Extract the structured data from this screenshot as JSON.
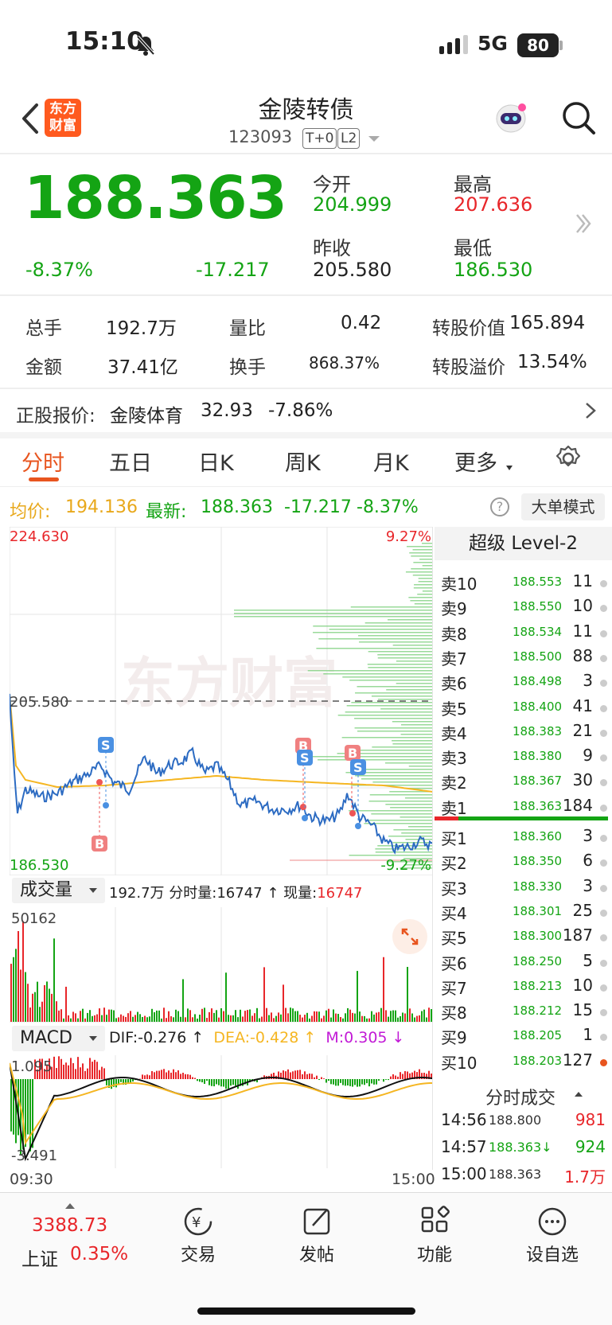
{
  "status_bar": {
    "time": "15:10",
    "network": "5G",
    "battery": "80"
  },
  "header": {
    "logo": [
      "东方",
      "财富"
    ],
    "title": "金陵转债",
    "code": "123093",
    "tags": [
      "T+0",
      "L2"
    ]
  },
  "quote": {
    "price": "188.363",
    "change_pct": "-8.37%",
    "change": "-17.217",
    "open_label": "今开",
    "open": "204.999",
    "high_label": "最高",
    "high": "207.636",
    "prev_close_label": "昨收",
    "prev_close": "205.580",
    "low_label": "最低",
    "low": "186.530"
  },
  "stats": {
    "volume_label": "总手",
    "volume": "192.7万",
    "vol_ratio_label": "量比",
    "vol_ratio": "0.42",
    "conv_value_label": "转股价值",
    "conv_value": "165.894",
    "amount_label": "金额",
    "amount": "37.41亿",
    "turnover_label": "换手",
    "turnover": "868.37%",
    "premium_label": "转股溢价",
    "premium": "13.54%"
  },
  "underlying": {
    "label": "正股报价:",
    "name": "金陵体育",
    "price": "32.93",
    "change_pct": "-7.86%"
  },
  "tabs": [
    "分时",
    "五日",
    "日K",
    "周K",
    "月K",
    "更多"
  ],
  "avg_row": {
    "avg_label": "均价:",
    "avg": "194.136",
    "last_label": "最新:",
    "last": "188.363",
    "chg": "-17.217",
    "pct": "-8.37%",
    "mode_button": "大单模式"
  },
  "chart_labels": {
    "y_max": "224.630",
    "y_ref": "205.580",
    "y_min": "186.530",
    "pct_max": "9.27%",
    "pct_min": "-9.27%",
    "watermark": "东方财富",
    "t_start": "09:30",
    "t_end": "15:00",
    "vol_max": "50162",
    "macd_max": "1.095",
    "macd_min": "-3.491"
  },
  "volume_bar": {
    "selector": "成交量",
    "total": "192.7万",
    "minute_label": "分时量:",
    "minute": "16747",
    "now_label": "现量:",
    "now": "16747"
  },
  "macd_bar": {
    "selector": "MACD",
    "dif": "DIF:-0.276",
    "dea": "DEA:-0.428",
    "m": "M:0.305"
  },
  "order_book": {
    "title": "超级 Level-2",
    "asks": [
      {
        "name": "卖10",
        "price": "188.553",
        "vol": "11"
      },
      {
        "name": "卖9",
        "price": "188.550",
        "vol": "10"
      },
      {
        "name": "卖8",
        "price": "188.534",
        "vol": "11"
      },
      {
        "name": "卖7",
        "price": "188.500",
        "vol": "88"
      },
      {
        "name": "卖6",
        "price": "188.498",
        "vol": "3"
      },
      {
        "name": "卖5",
        "price": "188.400",
        "vol": "41"
      },
      {
        "name": "卖4",
        "price": "188.383",
        "vol": "21"
      },
      {
        "name": "卖3",
        "price": "188.380",
        "vol": "9"
      },
      {
        "name": "卖2",
        "price": "188.367",
        "vol": "30"
      },
      {
        "name": "卖1",
        "price": "188.363",
        "vol": "184"
      }
    ],
    "bids": [
      {
        "name": "买1",
        "price": "188.360",
        "vol": "3"
      },
      {
        "name": "买2",
        "price": "188.350",
        "vol": "6"
      },
      {
        "name": "买3",
        "price": "188.330",
        "vol": "3"
      },
      {
        "name": "买4",
        "price": "188.301",
        "vol": "25"
      },
      {
        "name": "买5",
        "price": "188.300",
        "vol": "187"
      },
      {
        "name": "买6",
        "price": "188.250",
        "vol": "5"
      },
      {
        "name": "买7",
        "price": "188.213",
        "vol": "10"
      },
      {
        "name": "买8",
        "price": "188.212",
        "vol": "15"
      },
      {
        "name": "买9",
        "price": "188.205",
        "vol": "1"
      },
      {
        "name": "买10",
        "price": "188.203",
        "vol": "127"
      }
    ],
    "trades_title": "分时成交",
    "trades": [
      {
        "time": "14:56",
        "price": "188.800",
        "vol": "981"
      },
      {
        "time": "14:57",
        "price": "188.363",
        "vol": "924"
      },
      {
        "time": "15:00",
        "price": "188.363",
        "vol": "1.7万"
      }
    ]
  },
  "bottom_nav": {
    "index_value": "3388.73",
    "index_name": "上证",
    "index_pct": "0.35%",
    "items": [
      "交易",
      "发帖",
      "功能",
      "设自选"
    ]
  }
}
